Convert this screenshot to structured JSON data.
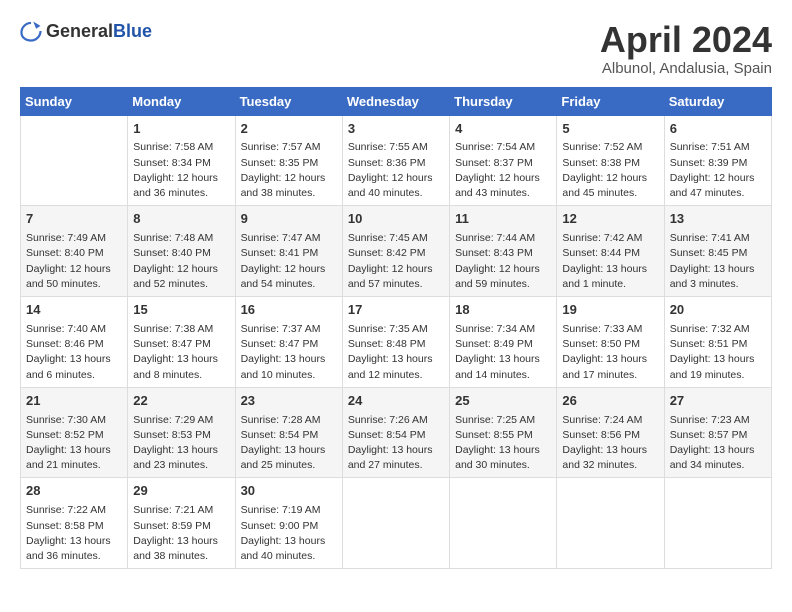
{
  "logo": {
    "general": "General",
    "blue": "Blue"
  },
  "title": "April 2024",
  "location": "Albunol, Andalusia, Spain",
  "days_of_week": [
    "Sunday",
    "Monday",
    "Tuesday",
    "Wednesday",
    "Thursday",
    "Friday",
    "Saturday"
  ],
  "weeks": [
    [
      {
        "day": "",
        "info": ""
      },
      {
        "day": "1",
        "info": "Sunrise: 7:58 AM\nSunset: 8:34 PM\nDaylight: 12 hours\nand 36 minutes."
      },
      {
        "day": "2",
        "info": "Sunrise: 7:57 AM\nSunset: 8:35 PM\nDaylight: 12 hours\nand 38 minutes."
      },
      {
        "day": "3",
        "info": "Sunrise: 7:55 AM\nSunset: 8:36 PM\nDaylight: 12 hours\nand 40 minutes."
      },
      {
        "day": "4",
        "info": "Sunrise: 7:54 AM\nSunset: 8:37 PM\nDaylight: 12 hours\nand 43 minutes."
      },
      {
        "day": "5",
        "info": "Sunrise: 7:52 AM\nSunset: 8:38 PM\nDaylight: 12 hours\nand 45 minutes."
      },
      {
        "day": "6",
        "info": "Sunrise: 7:51 AM\nSunset: 8:39 PM\nDaylight: 12 hours\nand 47 minutes."
      }
    ],
    [
      {
        "day": "7",
        "info": "Sunrise: 7:49 AM\nSunset: 8:40 PM\nDaylight: 12 hours\nand 50 minutes."
      },
      {
        "day": "8",
        "info": "Sunrise: 7:48 AM\nSunset: 8:40 PM\nDaylight: 12 hours\nand 52 minutes."
      },
      {
        "day": "9",
        "info": "Sunrise: 7:47 AM\nSunset: 8:41 PM\nDaylight: 12 hours\nand 54 minutes."
      },
      {
        "day": "10",
        "info": "Sunrise: 7:45 AM\nSunset: 8:42 PM\nDaylight: 12 hours\nand 57 minutes."
      },
      {
        "day": "11",
        "info": "Sunrise: 7:44 AM\nSunset: 8:43 PM\nDaylight: 12 hours\nand 59 minutes."
      },
      {
        "day": "12",
        "info": "Sunrise: 7:42 AM\nSunset: 8:44 PM\nDaylight: 13 hours\nand 1 minute."
      },
      {
        "day": "13",
        "info": "Sunrise: 7:41 AM\nSunset: 8:45 PM\nDaylight: 13 hours\nand 3 minutes."
      }
    ],
    [
      {
        "day": "14",
        "info": "Sunrise: 7:40 AM\nSunset: 8:46 PM\nDaylight: 13 hours\nand 6 minutes."
      },
      {
        "day": "15",
        "info": "Sunrise: 7:38 AM\nSunset: 8:47 PM\nDaylight: 13 hours\nand 8 minutes."
      },
      {
        "day": "16",
        "info": "Sunrise: 7:37 AM\nSunset: 8:47 PM\nDaylight: 13 hours\nand 10 minutes."
      },
      {
        "day": "17",
        "info": "Sunrise: 7:35 AM\nSunset: 8:48 PM\nDaylight: 13 hours\nand 12 minutes."
      },
      {
        "day": "18",
        "info": "Sunrise: 7:34 AM\nSunset: 8:49 PM\nDaylight: 13 hours\nand 14 minutes."
      },
      {
        "day": "19",
        "info": "Sunrise: 7:33 AM\nSunset: 8:50 PM\nDaylight: 13 hours\nand 17 minutes."
      },
      {
        "day": "20",
        "info": "Sunrise: 7:32 AM\nSunset: 8:51 PM\nDaylight: 13 hours\nand 19 minutes."
      }
    ],
    [
      {
        "day": "21",
        "info": "Sunrise: 7:30 AM\nSunset: 8:52 PM\nDaylight: 13 hours\nand 21 minutes."
      },
      {
        "day": "22",
        "info": "Sunrise: 7:29 AM\nSunset: 8:53 PM\nDaylight: 13 hours\nand 23 minutes."
      },
      {
        "day": "23",
        "info": "Sunrise: 7:28 AM\nSunset: 8:54 PM\nDaylight: 13 hours\nand 25 minutes."
      },
      {
        "day": "24",
        "info": "Sunrise: 7:26 AM\nSunset: 8:54 PM\nDaylight: 13 hours\nand 27 minutes."
      },
      {
        "day": "25",
        "info": "Sunrise: 7:25 AM\nSunset: 8:55 PM\nDaylight: 13 hours\nand 30 minutes."
      },
      {
        "day": "26",
        "info": "Sunrise: 7:24 AM\nSunset: 8:56 PM\nDaylight: 13 hours\nand 32 minutes."
      },
      {
        "day": "27",
        "info": "Sunrise: 7:23 AM\nSunset: 8:57 PM\nDaylight: 13 hours\nand 34 minutes."
      }
    ],
    [
      {
        "day": "28",
        "info": "Sunrise: 7:22 AM\nSunset: 8:58 PM\nDaylight: 13 hours\nand 36 minutes."
      },
      {
        "day": "29",
        "info": "Sunrise: 7:21 AM\nSunset: 8:59 PM\nDaylight: 13 hours\nand 38 minutes."
      },
      {
        "day": "30",
        "info": "Sunrise: 7:19 AM\nSunset: 9:00 PM\nDaylight: 13 hours\nand 40 minutes."
      },
      {
        "day": "",
        "info": ""
      },
      {
        "day": "",
        "info": ""
      },
      {
        "day": "",
        "info": ""
      },
      {
        "day": "",
        "info": ""
      }
    ]
  ]
}
